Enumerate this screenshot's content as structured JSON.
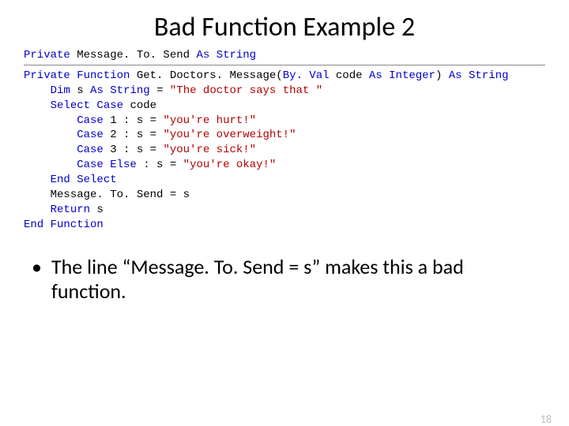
{
  "title": "Bad Function Example 2",
  "code": {
    "ind0": "",
    "ind1": "    ",
    "ind2": "        ",
    "kw_private": "Private",
    "kw_function": "Function",
    "kw_as": "As",
    "kw_string": "String",
    "kw_integer": "Integer",
    "kw_dim": "Dim",
    "kw_select": "Select Case",
    "kw_case": "Case",
    "kw_case_else": "Case Else",
    "kw_end_select": "End Select",
    "kw_return": "Return",
    "kw_end_function": "End Function",
    "kw_byval": "By. Val",
    "id_mts": "Message. To. Send",
    "id_func": "Get. Doctors. Message",
    "id_code": "code",
    "id_s": "s",
    "lit_intro": "\"The doctor says that \"",
    "n1": "1",
    "lit1": "\"you're hurt!\"",
    "n2": "2",
    "lit2": "\"you're overweight!\"",
    "n3": "3",
    "lit3": "\"you're sick!\"",
    "lit_else": "\"you're okay!\"",
    "assign_mts": "Message. To. Send = s",
    "eq": " = ",
    "open_paren": "(",
    "close_paren": ")",
    "colon_seg": " : s = ",
    "space": " "
  },
  "bullet_text": "The line “Message. To. Send = s” makes this a bad function.",
  "page_number": "18"
}
